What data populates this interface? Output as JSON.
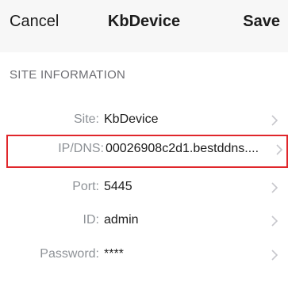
{
  "nav": {
    "cancel_label": "Cancel",
    "title": "KbDevice",
    "save_label": "Save"
  },
  "section": {
    "header": "SITE INFORMATION"
  },
  "rows": [
    {
      "label": "Site:",
      "value": "KbDevice"
    },
    {
      "label": "IP/DNS:",
      "value": "00026908c2d1.bestddns...."
    },
    {
      "label": "Port:",
      "value": "5445"
    },
    {
      "label": "ID:",
      "value": "admin"
    },
    {
      "label": "Password:",
      "value": "****"
    }
  ],
  "colors": {
    "highlight_border": "#e0262b",
    "label_gray": "#8e9297",
    "chevron": "#c7c7cc"
  }
}
